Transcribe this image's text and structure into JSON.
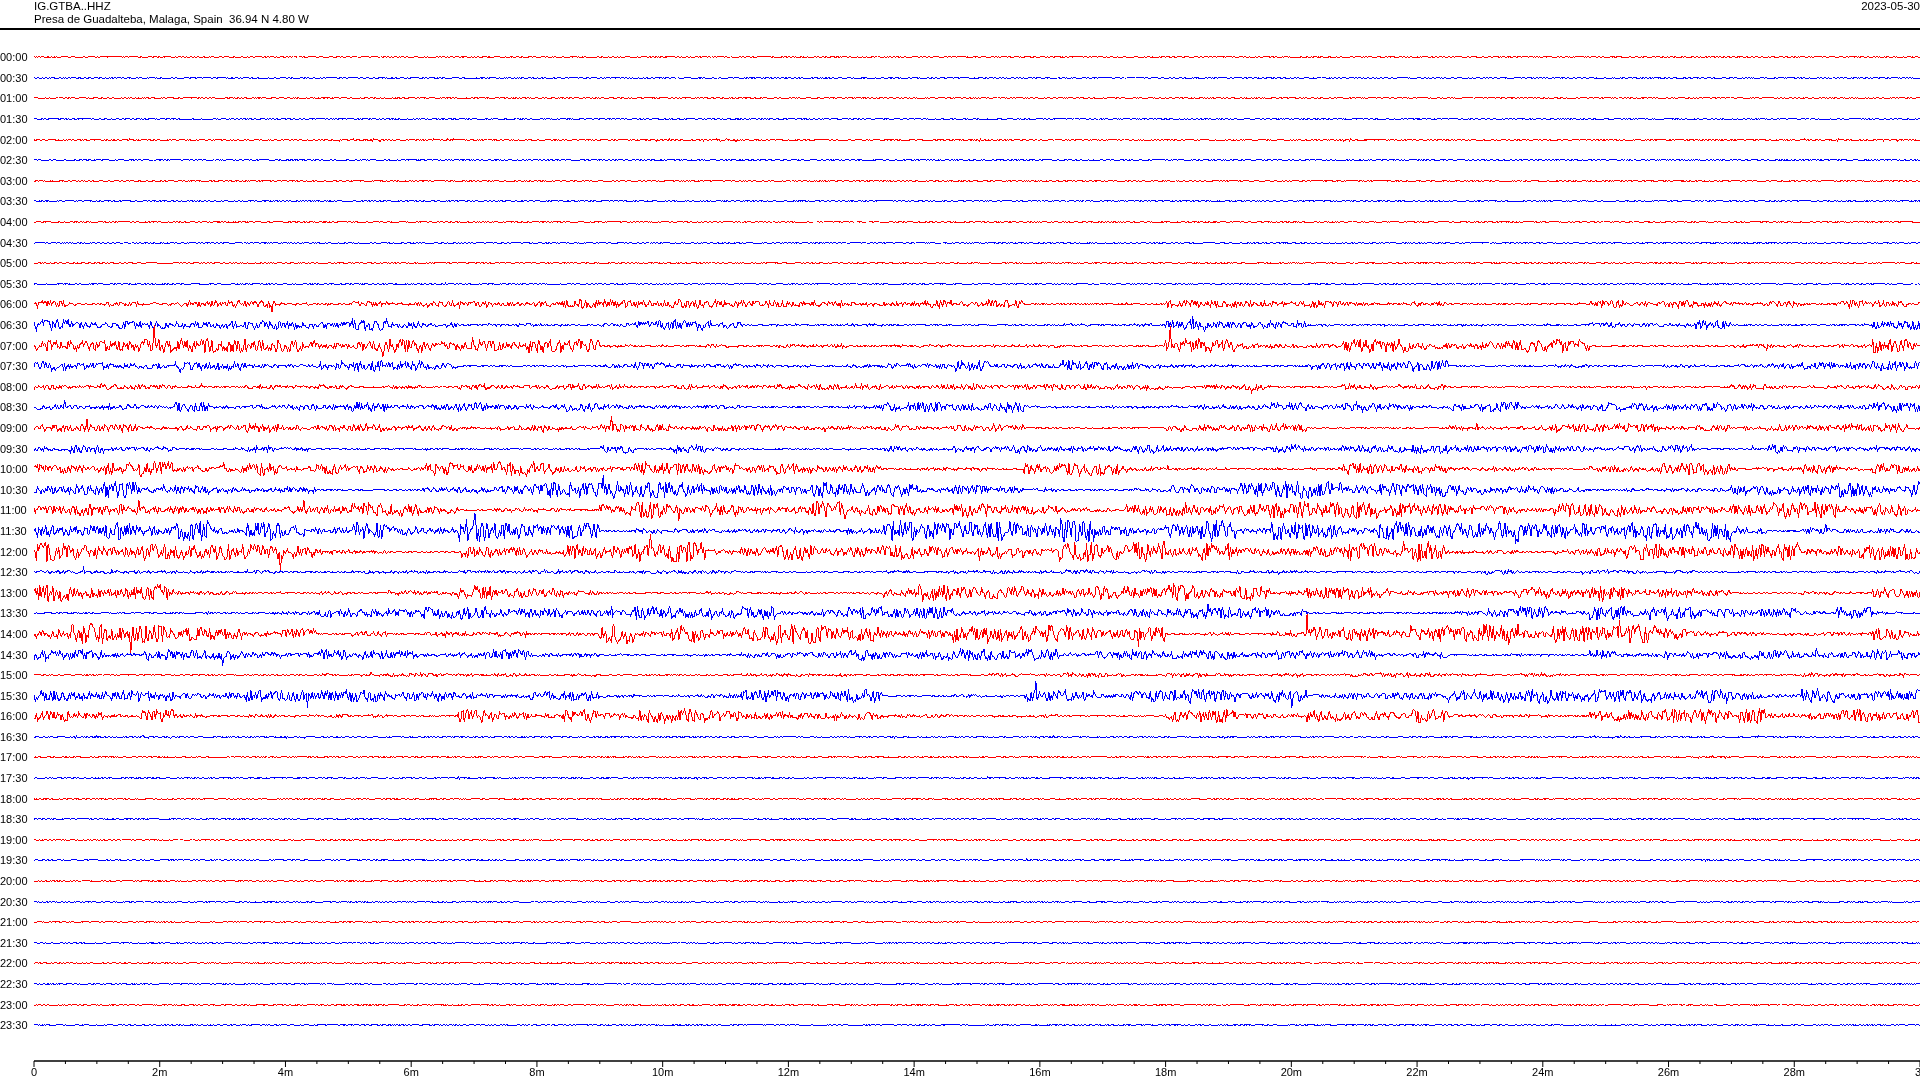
{
  "header": {
    "station": "IG.GTBA..HHZ",
    "location": "Presa de Guadalteba, Malaga, Spain  36.94 N 4.80 W",
    "date": "2023-05-30"
  },
  "traces": [
    {
      "label": "00:00",
      "color": "#ff0000"
    },
    {
      "label": "00:30",
      "color": "#0000ff"
    },
    {
      "label": "01:00",
      "color": "#ff0000"
    },
    {
      "label": "01:30",
      "color": "#0000ff"
    },
    {
      "label": "02:00",
      "color": "#ff0000"
    },
    {
      "label": "02:30",
      "color": "#0000ff"
    },
    {
      "label": "03:00",
      "color": "#ff0000"
    },
    {
      "label": "03:30",
      "color": "#0000ff"
    },
    {
      "label": "04:00",
      "color": "#ff0000"
    },
    {
      "label": "04:30",
      "color": "#0000ff"
    },
    {
      "label": "05:00",
      "color": "#ff0000"
    },
    {
      "label": "05:30",
      "color": "#0000ff"
    },
    {
      "label": "06:00",
      "color": "#ff0000"
    },
    {
      "label": "06:30",
      "color": "#0000ff"
    },
    {
      "label": "07:00",
      "color": "#ff0000"
    },
    {
      "label": "07:30",
      "color": "#0000ff"
    },
    {
      "label": "08:00",
      "color": "#ff0000"
    },
    {
      "label": "08:30",
      "color": "#0000ff"
    },
    {
      "label": "09:00",
      "color": "#ff0000"
    },
    {
      "label": "09:30",
      "color": "#0000ff"
    },
    {
      "label": "10:00",
      "color": "#ff0000"
    },
    {
      "label": "10:30",
      "color": "#0000ff"
    },
    {
      "label": "11:00",
      "color": "#ff0000"
    },
    {
      "label": "11:30",
      "color": "#0000ff"
    },
    {
      "label": "12:00",
      "color": "#ff0000"
    },
    {
      "label": "12:30",
      "color": "#0000ff"
    },
    {
      "label": "13:00",
      "color": "#ff0000"
    },
    {
      "label": "13:30",
      "color": "#0000ff"
    },
    {
      "label": "14:00",
      "color": "#ff0000"
    },
    {
      "label": "14:30",
      "color": "#0000ff"
    },
    {
      "label": "15:00",
      "color": "#ff0000"
    },
    {
      "label": "15:30",
      "color": "#0000ff"
    },
    {
      "label": "16:00",
      "color": "#ff0000"
    },
    {
      "label": "16:30",
      "color": "#0000ff"
    },
    {
      "label": "17:00",
      "color": "#ff0000"
    },
    {
      "label": "17:30",
      "color": "#0000ff"
    },
    {
      "label": "18:00",
      "color": "#ff0000"
    },
    {
      "label": "18:30",
      "color": "#0000ff"
    },
    {
      "label": "19:00",
      "color": "#ff0000"
    },
    {
      "label": "19:30",
      "color": "#0000ff"
    },
    {
      "label": "20:00",
      "color": "#ff0000"
    },
    {
      "label": "20:30",
      "color": "#0000ff"
    },
    {
      "label": "21:00",
      "color": "#ff0000"
    },
    {
      "label": "21:30",
      "color": "#0000ff"
    },
    {
      "label": "22:00",
      "color": "#ff0000"
    },
    {
      "label": "22:30",
      "color": "#0000ff"
    },
    {
      "label": "23:00",
      "color": "#ff0000"
    },
    {
      "label": "23:30",
      "color": "#0000ff"
    }
  ],
  "axis": {
    "ticks": [
      "0",
      "2m",
      "4m",
      "6m",
      "8m",
      "10m",
      "12m",
      "14m",
      "16m",
      "18m",
      "20m",
      "22m",
      "24m",
      "26m",
      "28m",
      "3"
    ]
  }
}
